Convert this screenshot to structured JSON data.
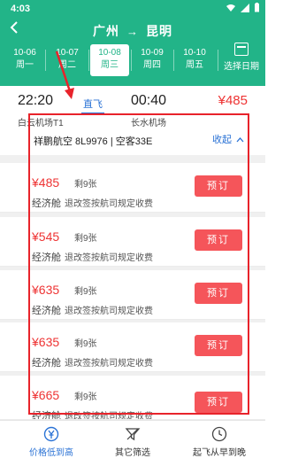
{
  "status_bar": {
    "time": "4:03"
  },
  "header": {
    "origin": "广州",
    "arrow": "→",
    "destination": "昆明"
  },
  "dates": [
    {
      "date": "10-06",
      "weekday": "周一",
      "active": false
    },
    {
      "date": "10-07",
      "weekday": "周二",
      "active": false
    },
    {
      "date": "10-08",
      "weekday": "周三",
      "active": true
    },
    {
      "date": "10-09",
      "weekday": "周四",
      "active": false
    },
    {
      "date": "10-10",
      "weekday": "周五",
      "active": false
    }
  ],
  "select_date_label": "选择日期",
  "flight": {
    "dep_time": "22:20",
    "direct_label": "直飞",
    "arr_time": "00:40",
    "price": "¥485",
    "dep_airport": "白云机场T1",
    "arr_airport": "长水机场",
    "info": "祥鹏航空 8L9976 | 空客33E",
    "collapse_label": "收起"
  },
  "fares": [
    {
      "price": "¥485",
      "seats": "剩9张",
      "cabin": "经济舱",
      "rule": "退改签按航司规定收费",
      "button": "预订"
    },
    {
      "price": "¥545",
      "seats": "剩9张",
      "cabin": "经济舱",
      "rule": "退改签按航司规定收费",
      "button": "预订"
    },
    {
      "price": "¥635",
      "seats": "剩9张",
      "cabin": "经济舱",
      "rule": "退改签按航司规定收费",
      "button": "预订"
    },
    {
      "price": "¥635",
      "seats": "剩9张",
      "cabin": "经济舱",
      "rule": "退改签按航司规定收费",
      "button": "预订"
    },
    {
      "price": "¥665",
      "seats": "剩9张",
      "cabin": "经济舱",
      "rule": "退改签按航司规定收费",
      "button": "预订"
    }
  ],
  "bottom_nav": [
    {
      "label": "价格低到高",
      "icon": "yen-sort-icon",
      "active": true
    },
    {
      "label": "其它筛选",
      "icon": "filter-icon",
      "active": false
    },
    {
      "label": "起飞从早到晚",
      "icon": "clock-icon",
      "active": false
    }
  ],
  "colors": {
    "brand_green": "#22b488",
    "price_red": "#ee3333",
    "book_button": "#f5555a",
    "link_blue": "#2a72d5",
    "annotation_red": "#e8232b"
  }
}
